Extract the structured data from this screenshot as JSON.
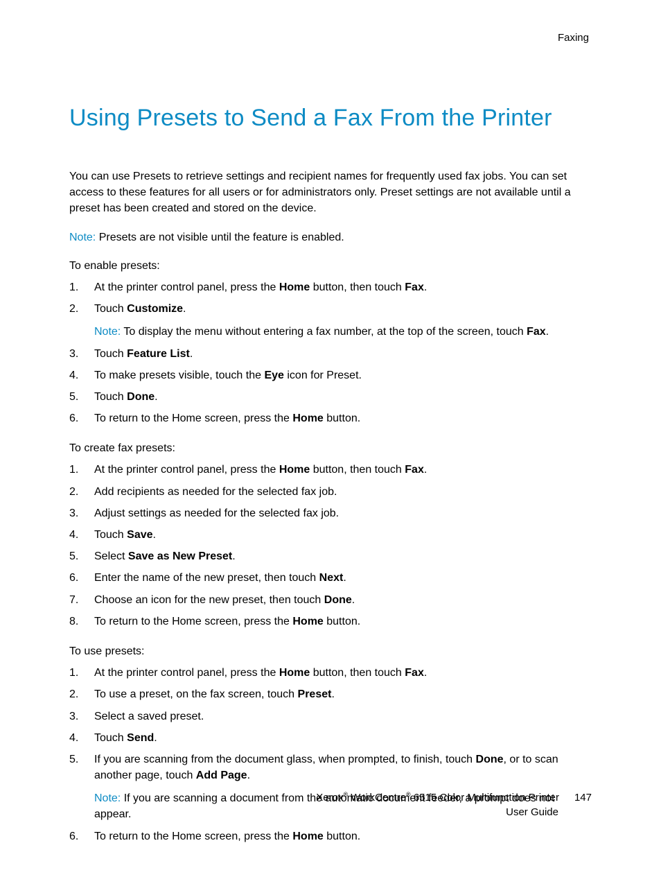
{
  "header": {
    "section": "Faxing"
  },
  "title": "Using Presets to Send a Fax From the Printer",
  "intro": "You can use Presets to retrieve settings and recipient names for frequently used fax jobs. You can set access to these features for all users or for administrators only. Preset settings are not available until a preset has been created and stored on the device.",
  "note1_label": "Note:",
  "note1_text": " Presets are not visible until the feature is enabled.",
  "sectionA_intro": "To enable presets:",
  "sectionA": {
    "s1_a": "At the printer control panel, press the ",
    "s1_b": "Home",
    "s1_c": " button, then touch ",
    "s1_d": "Fax",
    "s1_e": ".",
    "s2_a": "Touch ",
    "s2_b": "Customize",
    "s2_c": ".",
    "s2_note_label": "Note:",
    "s2_note_a": " To display the menu without entering a fax number, at the top of the screen, touch ",
    "s2_note_b": "Fax",
    "s2_note_c": ".",
    "s3_a": "Touch ",
    "s3_b": "Feature List",
    "s3_c": ".",
    "s4_a": "To make presets visible, touch the ",
    "s4_b": "Eye",
    "s4_c": " icon for Preset.",
    "s5_a": "Touch ",
    "s5_b": "Done",
    "s5_c": ".",
    "s6_a": "To return to the Home screen, press the ",
    "s6_b": "Home",
    "s6_c": " button."
  },
  "sectionB_intro": "To create fax presets:",
  "sectionB": {
    "s1_a": "At the printer control panel, press the ",
    "s1_b": "Home",
    "s1_c": " button, then touch ",
    "s1_d": "Fax",
    "s1_e": ".",
    "s2": "Add recipients as needed for the selected fax job.",
    "s3": "Adjust settings as needed for the selected fax job.",
    "s4_a": "Touch ",
    "s4_b": "Save",
    "s4_c": ".",
    "s5_a": "Select ",
    "s5_b": "Save as New Preset",
    "s5_c": ".",
    "s6_a": "Enter the name of the new preset, then touch ",
    "s6_b": "Next",
    "s6_c": ".",
    "s7_a": "Choose an icon for the new preset, then touch ",
    "s7_b": "Done",
    "s7_c": ".",
    "s8_a": "To return to the Home screen, press the ",
    "s8_b": "Home",
    "s8_c": " button."
  },
  "sectionC_intro": "To use presets:",
  "sectionC": {
    "s1_a": "At the printer control panel, press the ",
    "s1_b": "Home",
    "s1_c": " button, then touch ",
    "s1_d": "Fax",
    "s1_e": ".",
    "s2_a": "To use a preset, on the fax screen, touch ",
    "s2_b": "Preset",
    "s2_c": ".",
    "s3": "Select a saved preset.",
    "s4_a": "Touch ",
    "s4_b": "Send",
    "s4_c": ".",
    "s5_a": "If you are scanning from the document glass, when prompted, to finish, touch ",
    "s5_b": "Done",
    "s5_c": ", or to scan another page, touch ",
    "s5_d": "Add Page",
    "s5_e": ".",
    "s5_note_label": "Note:",
    "s5_note_text": " If you are scanning a document from the automatic document feeder, a prompt does not appear.",
    "s6_a": "To return to the Home screen, press the ",
    "s6_b": "Home",
    "s6_c": " button."
  },
  "footer": {
    "brand_a": "Xerox",
    "reg": "®",
    "brand_b": " WorkCentre",
    "brand_c": " 6515 Color Multifunction Printer",
    "line2": "User Guide",
    "pagenum": "147"
  }
}
